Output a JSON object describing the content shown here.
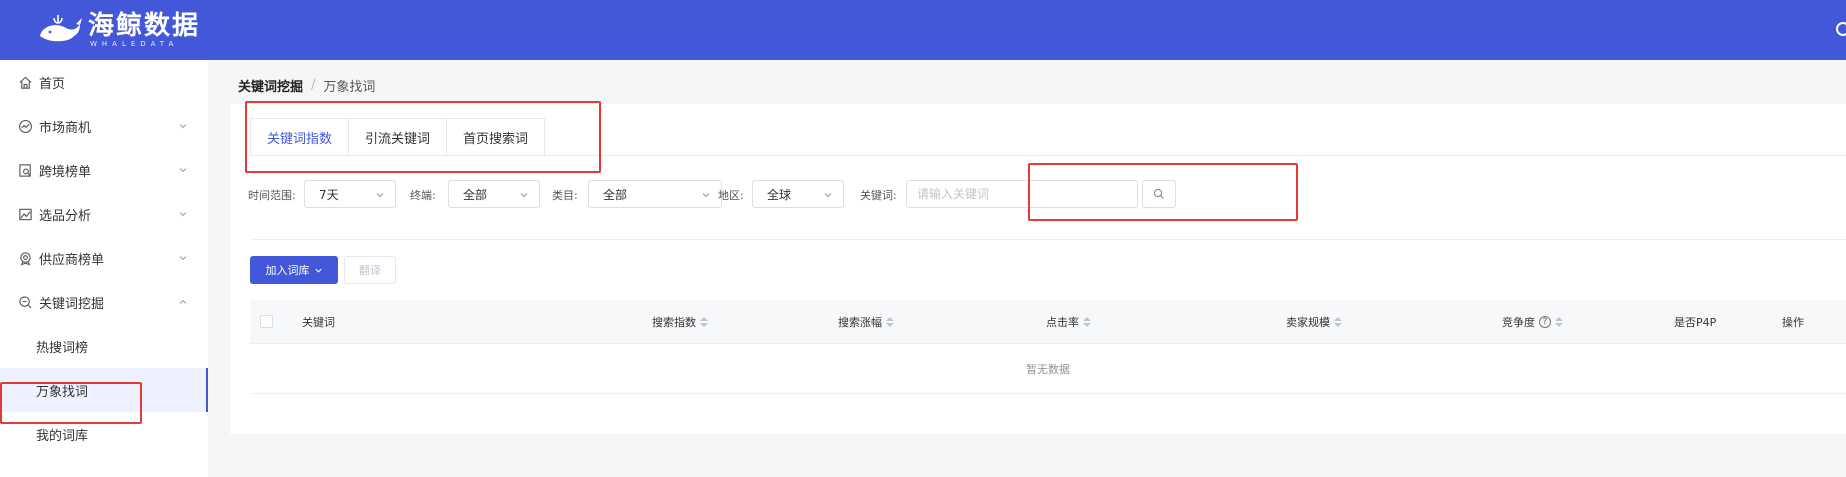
{
  "header": {
    "logo_cn": "海鲸数据",
    "logo_en": "WHALEDATA",
    "bg_color": "#4358d8"
  },
  "sidebar": {
    "items": [
      {
        "label": "首页",
        "icon": "home-icon"
      },
      {
        "label": "市场商机",
        "icon": "trend-icon"
      },
      {
        "label": "跨境榜单",
        "icon": "list-search-icon"
      },
      {
        "label": "选品分析",
        "icon": "image-chart-icon"
      },
      {
        "label": "供应商榜单",
        "icon": "supplier-icon"
      },
      {
        "label": "关键词挖掘",
        "icon": "search-icon"
      }
    ],
    "sub_items": [
      {
        "label": "热搜词榜"
      },
      {
        "label": "万象找词",
        "active": true
      },
      {
        "label": "我的词库"
      }
    ]
  },
  "breadcrumb": {
    "parent": "关键词挖掘",
    "separator": "/",
    "current": "万象找词"
  },
  "tabs": [
    {
      "label": "关键词指数",
      "active": true
    },
    {
      "label": "引流关键词"
    },
    {
      "label": "首页搜索词"
    }
  ],
  "filters": {
    "time_label": "时间范围:",
    "time_value": "7天",
    "device_label": "终端:",
    "device_value": "全部",
    "category_label": "类目:",
    "category_value": "全部",
    "region_label": "地区:",
    "region_value": "全球",
    "keyword_label": "关键词:",
    "keyword_placeholder": "请输入关键词"
  },
  "actions": {
    "add_label": "加入词库",
    "translate_label": "翻译"
  },
  "table": {
    "columns": {
      "keyword": "关键词",
      "search_index": "搜索指数",
      "search_growth": "搜索涨幅",
      "ctr": "点击率",
      "seller_scale": "卖家规模",
      "competition": "竞争度",
      "p4p": "是否P4P",
      "ops": "操作"
    },
    "empty_text": "暂无数据"
  },
  "colors": {
    "primary": "#4358d8",
    "annotation": "#e53935"
  }
}
